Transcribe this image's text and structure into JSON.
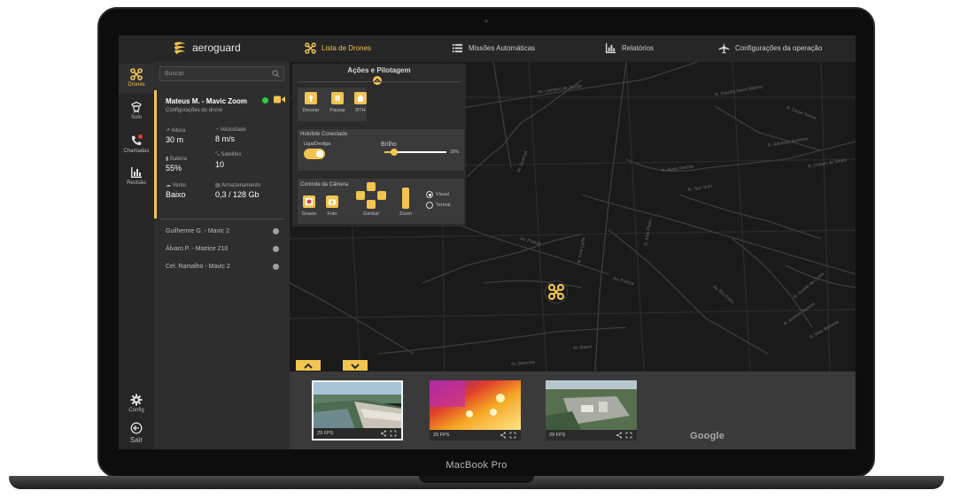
{
  "device": {
    "label": "MacBook Pro"
  },
  "app": {
    "brand": "aeroguard",
    "accent": "#f2c450",
    "nav": [
      {
        "label": "Lista de Drones",
        "icon": "drone-icon",
        "active": true
      },
      {
        "label": "Missões Automáticas",
        "icon": "list-icon",
        "active": false
      },
      {
        "label": "Relatórios",
        "icon": "bar-chart-icon",
        "active": false
      },
      {
        "label": "Configurações da operação",
        "icon": "plane-icon",
        "active": false
      }
    ]
  },
  "rail": {
    "items": [
      {
        "label": "Drones",
        "icon": "drone-icon",
        "active": true
      },
      {
        "label": "Solo",
        "icon": "officer-icon",
        "active": false
      },
      {
        "label": "Chamadas",
        "icon": "phone-icon",
        "active": false,
        "badge": "#e23b3b"
      },
      {
        "label": "Revisão",
        "icon": "bar-chart-icon",
        "active": false
      }
    ],
    "bottom": [
      {
        "label": "Config",
        "icon": "gear-icon"
      },
      {
        "label": "Sair",
        "icon": "exit-icon"
      }
    ]
  },
  "drones": {
    "search_placeholder": "Buscar",
    "active": {
      "name": "Mateus M. - Mavic Zoom",
      "subtitle": "Configurações do drone",
      "status_color": "#2ecc40",
      "stats": {
        "altitude": {
          "label": "Altura",
          "value": "30 m"
        },
        "speed": {
          "label": "Velocidade",
          "value": "8 m/s"
        },
        "battery": {
          "label": "Bateria",
          "value": "55%"
        },
        "satellites": {
          "label": "Satélites",
          "value": "10"
        },
        "wind": {
          "label": "Vento",
          "value": "Baixo"
        },
        "storage": {
          "label": "Armazenamento",
          "value": "0,3 / 128 Gb"
        }
      }
    },
    "others": [
      {
        "name": "Guilherme G. - Mavic 2"
      },
      {
        "name": "Álvaro P. - Matrice 210"
      },
      {
        "name": "Cel. Ramalho - Mavic 2"
      }
    ]
  },
  "actions": {
    "title": "Ações e Pilotagem",
    "flight_buttons": [
      {
        "label": "Decolar",
        "icon": "takeoff-icon"
      },
      {
        "label": "Pausar",
        "icon": "pause-icon"
      },
      {
        "label": "RTH",
        "icon": "home-icon"
      }
    ],
    "spotlight": {
      "title": "Holofote Conectado",
      "toggle_label": "Liga/Desliga",
      "toggle_on": true,
      "brightness_label": "Brilho",
      "brightness_value": "16%",
      "brightness_fraction": 0.16
    },
    "camera": {
      "title": "Controle da Câmera",
      "record_label": "Gravar",
      "photo_label": "Foto",
      "gimbal_label": "Gimbal",
      "zoom_label": "Zoom",
      "modes": [
        {
          "label": "Visual",
          "selected": true
        },
        {
          "label": "Termal",
          "selected": false
        }
      ]
    }
  },
  "map": {
    "labels": [
      "Av. Campos de Jordão",
      "R. Otacílio Alves Martins",
      "R. Cézar Neves",
      "R. Admirais Barbosa",
      "R. Cidade de Seara",
      "R. Alves Martins",
      "Av. Guarujá",
      "R. Tom Sobr",
      "Av. França",
      "Av. França",
      "Av. Bauru",
      "Av. Barretos",
      "R. Aldo Piuzo",
      "R. Irmã Lydia",
      "R. Duarte da Costa",
      "R. Silas Barbosa",
      "Av. Rio Preto",
      "R. Antônio Tavares"
    ],
    "watermark": "Google"
  },
  "feeds": [
    {
      "fps": "29 FPS",
      "active": true,
      "kind": "aerial-dam"
    },
    {
      "fps": "29 FPS",
      "active": false,
      "kind": "thermal"
    },
    {
      "fps": "29 FPS",
      "active": false,
      "kind": "aerial-city"
    }
  ]
}
